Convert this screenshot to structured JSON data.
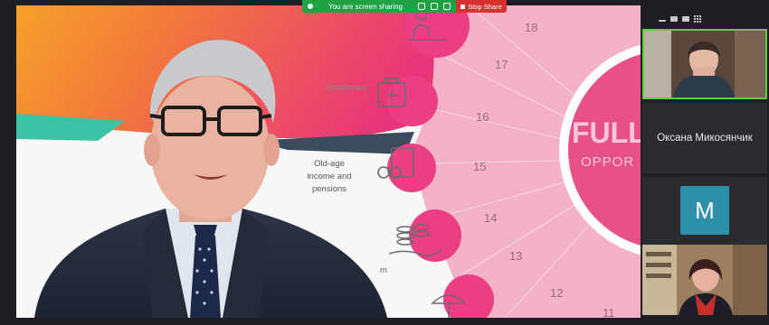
{
  "share_banner": {
    "status_text": "You are screen sharing",
    "stop_label": "Stop Share"
  },
  "slide": {
    "labels": {
      "healthcare": "Healthcare",
      "old_age": [
        "Old-age",
        "income and",
        "pensions"
      ],
      "partial": "m"
    },
    "numbers": [
      "18",
      "17",
      "16",
      "15",
      "14",
      "13",
      "12",
      "11"
    ],
    "center_title": "FULL",
    "center_subtitle": "OPPOR"
  },
  "participants": [
    {
      "name": "",
      "video": true,
      "active_speaker": true
    },
    {
      "name": "Оксана Микосянчик",
      "video": false
    },
    {
      "name": "",
      "avatar_letter": "M",
      "avatar_color": "#2e8fa8",
      "video": false
    },
    {
      "name": "",
      "video": true
    }
  ],
  "colors": {
    "accent_pink": "#e8357a",
    "share_green": "#1fa144",
    "stop_red": "#d9302f",
    "active_border": "#5ad13a"
  }
}
